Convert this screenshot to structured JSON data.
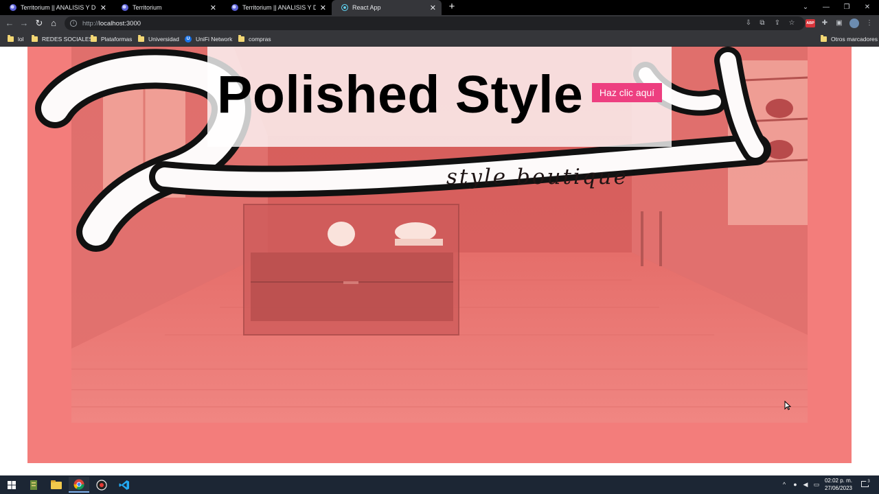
{
  "browser": {
    "tabs": [
      {
        "title": "Territorium || ANALISIS Y DESARR",
        "active": false
      },
      {
        "title": "Territorium",
        "active": false
      },
      {
        "title": "Territorium || ANALISIS Y DESARR",
        "active": false
      },
      {
        "title": "React App",
        "active": true
      }
    ],
    "new_tab": "+",
    "url_prefix": "http://",
    "url_host": "localhost:3000",
    "bookmarks": [
      {
        "label": "lol",
        "icon": "folder-icon"
      },
      {
        "label": "REDES SOCIALES",
        "icon": "folder-icon"
      },
      {
        "label": "Plataformas",
        "icon": "folder-icon"
      },
      {
        "label": "Universidad",
        "icon": "folder-icon"
      },
      {
        "label": "UniFi Network",
        "icon": "unifi-icon"
      },
      {
        "label": "compras",
        "icon": "folder-icon"
      }
    ],
    "other_bookmarks": "Otros marcadores",
    "extension_badge": "ABP"
  },
  "page": {
    "title": "Polished Style",
    "cta_label": "Haz clic aquí",
    "banner_logo": "Polished",
    "banner_tagline": "style boutique"
  },
  "taskbar": {
    "time": "02:02 p. m.",
    "date": "27/06/2023",
    "notifications": "3"
  },
  "colors": {
    "hero_background": "#f37d7b",
    "cta_background": "#ed3f80",
    "taskbar": "#1c2634",
    "browser_chrome": "#35363a"
  }
}
